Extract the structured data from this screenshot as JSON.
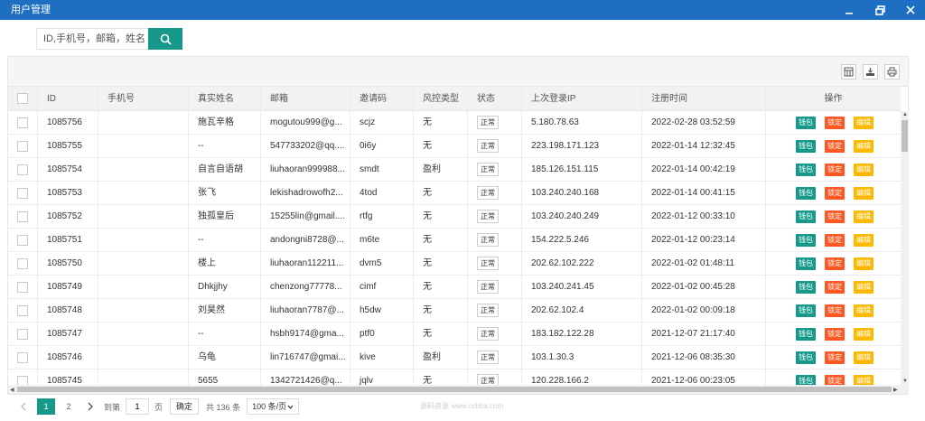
{
  "window": {
    "title": "用户管理"
  },
  "search": {
    "placeholder": "ID,手机号，邮箱，姓名"
  },
  "table": {
    "headers": [
      "ID",
      "手机号",
      "真实姓名",
      "邮箱",
      "邀请码",
      "风控类型",
      "状态",
      "上次登录IP",
      "注册时间",
      "操作"
    ],
    "row_buttons": {
      "wallet": "钱包",
      "lock": "锁定",
      "edit": "编辑"
    },
    "rows": [
      {
        "id": "1085756",
        "phone": "",
        "name": "施瓦辛格",
        "email": "mogutou999@g...",
        "invite": "scjz",
        "risk": "无",
        "status": "正常",
        "ip": "5.180.78.63",
        "time": "2022-02-28 03:52:59"
      },
      {
        "id": "1085755",
        "phone": "",
        "name": "--",
        "email": "547733202@qq....",
        "invite": "0i6y",
        "risk": "无",
        "status": "正常",
        "ip": "223.198.171.123",
        "time": "2022-01-14 12:32:45"
      },
      {
        "id": "1085754",
        "phone": "",
        "name": "自言自语胡",
        "email": "liuhaoran999988...",
        "invite": "smdt",
        "risk": "盈利",
        "status": "正常",
        "ip": "185.126.151.115",
        "time": "2022-01-14 00:42:19"
      },
      {
        "id": "1085753",
        "phone": "",
        "name": "张飞",
        "email": "lekishadrowofh2...",
        "invite": "4tod",
        "risk": "无",
        "status": "正常",
        "ip": "103.240.240.168",
        "time": "2022-01-14 00:41:15"
      },
      {
        "id": "1085752",
        "phone": "",
        "name": "独孤皇后",
        "email": "15255lin@gmail....",
        "invite": "rtfg",
        "risk": "无",
        "status": "正常",
        "ip": "103.240.240.249",
        "time": "2022-01-12 00:33:10"
      },
      {
        "id": "1085751",
        "phone": "",
        "name": "--",
        "email": "andongni8728@...",
        "invite": "m6te",
        "risk": "无",
        "status": "正常",
        "ip": "154.222.5.246",
        "time": "2022-01-12 00:23:14"
      },
      {
        "id": "1085750",
        "phone": "",
        "name": "楼上",
        "email": "liuhaoran112211...",
        "invite": "dvm5",
        "risk": "无",
        "status": "正常",
        "ip": "202.62.102.222",
        "time": "2022-01-02 01:48:11"
      },
      {
        "id": "1085749",
        "phone": "",
        "name": "Dhkjjhy",
        "email": "chenzong77778...",
        "invite": "cimf",
        "risk": "无",
        "status": "正常",
        "ip": "103.240.241.45",
        "time": "2022-01-02 00:45:28"
      },
      {
        "id": "1085748",
        "phone": "",
        "name": "刘昊然",
        "email": "liuhaoran7787@...",
        "invite": "h5dw",
        "risk": "无",
        "status": "正常",
        "ip": "202.62.102.4",
        "time": "2022-01-02 00:09:18"
      },
      {
        "id": "1085747",
        "phone": "",
        "name": "--",
        "email": "hsbh9174@gma...",
        "invite": "ptf0",
        "risk": "无",
        "status": "正常",
        "ip": "183.182.122.28",
        "time": "2021-12-07 21:17:40"
      },
      {
        "id": "1085746",
        "phone": "",
        "name": "乌龟",
        "email": "lin716747@gmai...",
        "invite": "kive",
        "risk": "盈利",
        "status": "正常",
        "ip": "103.1.30.3",
        "time": "2021-12-06 08:35:30"
      },
      {
        "id": "1085745",
        "phone": "",
        "name": "5655",
        "email": "1342721426@q...",
        "invite": "jqlv",
        "risk": "无",
        "status": "正常",
        "ip": "120.228.166.2",
        "time": "2021-12-06 00:23:05"
      }
    ]
  },
  "pagination": {
    "pages": [
      "1",
      "2"
    ],
    "goto_label": "到第",
    "goto_value": "1",
    "page_unit": "页",
    "confirm": "确定",
    "total": "共 136 条",
    "page_size": "100 条/页"
  },
  "watermark": "源码资源 www.ccbba.com",
  "colors": {
    "titlebar": "#1e6fc1",
    "primary": "#16998a",
    "danger": "#ff5722",
    "warn": "#ffb800"
  }
}
